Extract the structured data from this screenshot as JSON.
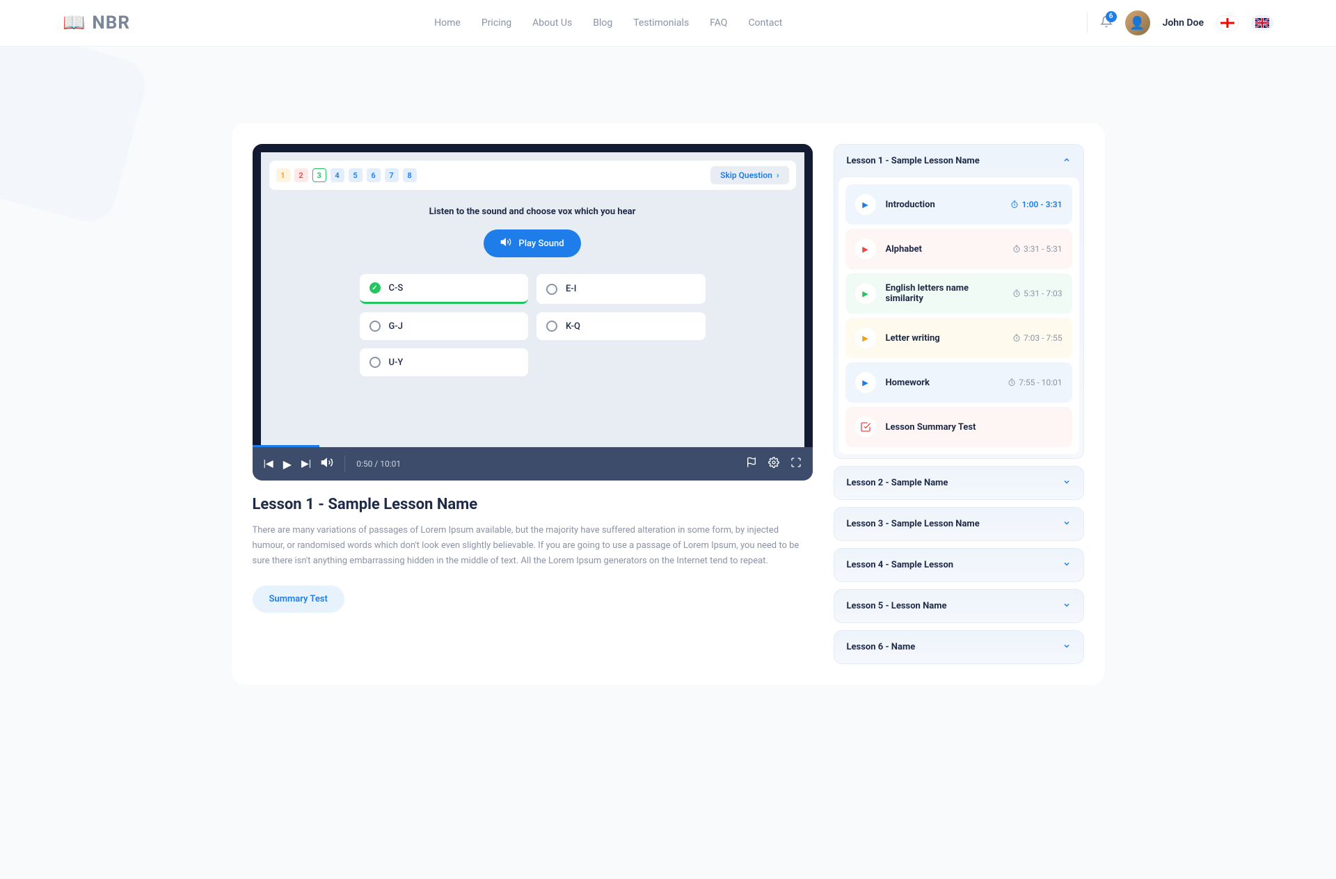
{
  "header": {
    "logo_text": "NBR",
    "nav": [
      "Home",
      "Pricing",
      "About Us",
      "Blog",
      "Testimonials",
      "FAQ",
      "Contact"
    ],
    "notifications": "6",
    "username": "John Doe"
  },
  "player": {
    "question_numbers": [
      {
        "n": "1",
        "class": "orange"
      },
      {
        "n": "2",
        "class": "red"
      },
      {
        "n": "3",
        "class": "green"
      },
      {
        "n": "4",
        "class": "blue"
      },
      {
        "n": "5",
        "class": "blue"
      },
      {
        "n": "6",
        "class": "blue"
      },
      {
        "n": "7",
        "class": "blue"
      },
      {
        "n": "8",
        "class": "blue"
      }
    ],
    "skip_label": "Skip Question",
    "question": "Listen to the sound and choose vox which you hear",
    "play_sound_label": "Play Sound",
    "options": [
      {
        "label": "C-S",
        "selected": true
      },
      {
        "label": "E-I",
        "selected": false
      },
      {
        "label": "G-J",
        "selected": false
      },
      {
        "label": "K-Q",
        "selected": false
      },
      {
        "label": "U-Y",
        "selected": false
      }
    ],
    "time": "0:50 / 10:01"
  },
  "lesson": {
    "title": "Lesson 1 - Sample Lesson Name",
    "description": "There are many variations of passages of Lorem Ipsum available, but the majority have suffered alteration in some form, by injected humour, or randomised words which don't look even slightly believable. If you are going to use a passage of Lorem Ipsum, you need to be sure there isn't anything embarrassing hidden in the middle of text. All the Lorem Ipsum generators on the Internet tend to repeat.",
    "summary_btn": "Summary Test"
  },
  "sidebar": {
    "expanded_title": "Lesson 1 - Sample Lesson Name",
    "chapters": [
      {
        "name": "Introduction",
        "time": "1:00 - 3:31",
        "color": "blue",
        "play": "bl",
        "active": true
      },
      {
        "name": "Alphabet",
        "time": "3:31 - 5:31",
        "color": "pink",
        "play": "rd",
        "active": false
      },
      {
        "name": "English letters name similarity",
        "time": "5:31 - 7:03",
        "color": "green",
        "play": "gr",
        "active": false
      },
      {
        "name": "Letter writing",
        "time": "7:03 - 7:55",
        "color": "yellow",
        "play": "yl",
        "active": false
      },
      {
        "name": "Homework",
        "time": "7:55 - 10:01",
        "color": "blue",
        "play": "bl",
        "active": false
      }
    ],
    "summary_test_label": "Lesson Summary Test",
    "collapsed": [
      "Lesson 2 - Sample Name",
      "Lesson 3 - Sample Lesson Name",
      "Lesson 4 - Sample Lesson",
      "Lesson 5 - Lesson Name",
      "Lesson 6 - Name"
    ]
  }
}
